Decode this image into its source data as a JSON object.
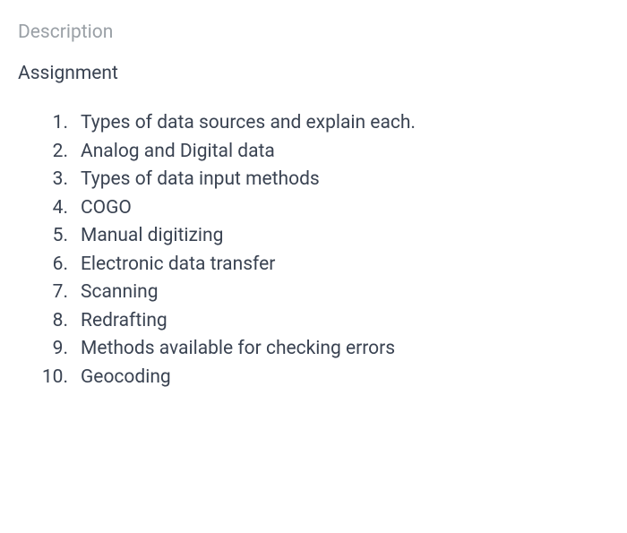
{
  "sectionLabel": "Description",
  "title": "Assignment",
  "items": [
    "Types of data sources and explain each.",
    "Analog and Digital data",
    "Types of data input methods",
    "COGO",
    "Manual digitizing",
    "Electronic data transfer",
    "Scanning",
    "Redrafting",
    "Methods available for checking errors",
    "Geocoding"
  ]
}
